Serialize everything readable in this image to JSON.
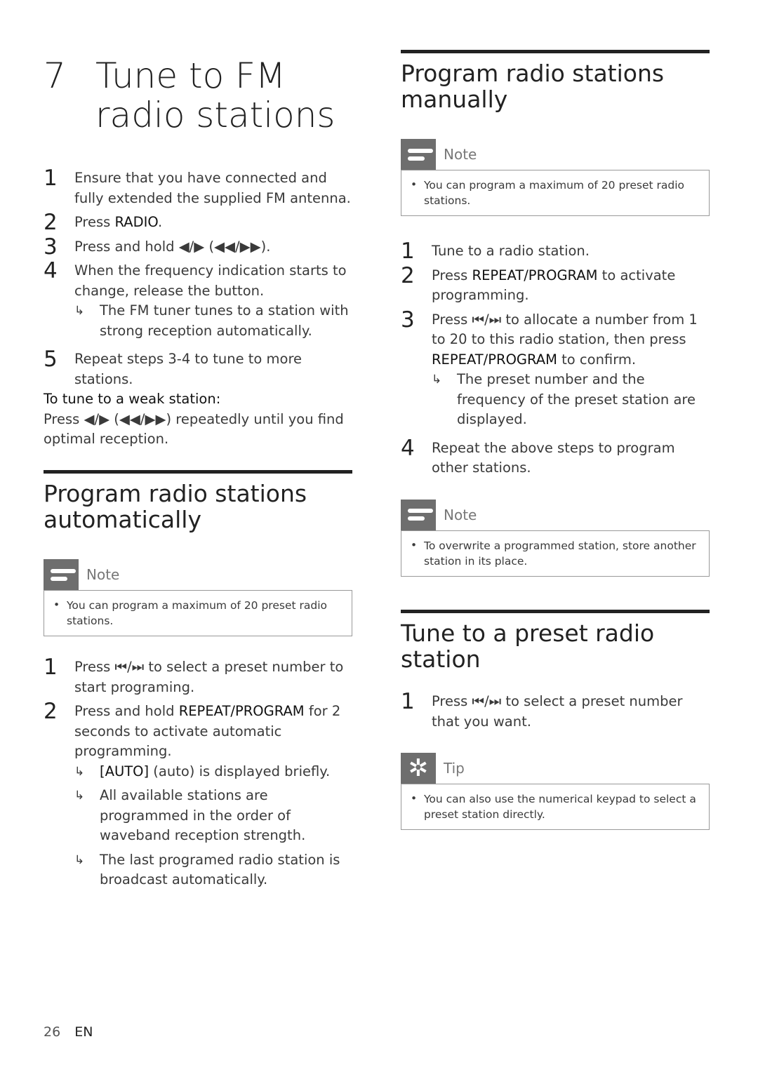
{
  "chapter": {
    "number": "7",
    "title": "Tune to FM radio stations"
  },
  "intro_steps": [
    {
      "n": "1",
      "text": "Ensure that you have connected and fully extended the supplied FM antenna."
    },
    {
      "n": "2",
      "pre": "Press ",
      "bold": "RADIO",
      "post": "."
    },
    {
      "n": "3",
      "text": "Press and hold ◀/▶ (◀◀/▶▶)."
    },
    {
      "n": "4",
      "text": "When the frequency indication starts to change, release the button.",
      "result": "The FM tuner tunes to a station with strong reception automatically."
    },
    {
      "n": "5",
      "text": "Repeat steps 3-4 to tune to more stations."
    }
  ],
  "weak_station": {
    "heading": "To tune to a weak station:",
    "text": "Press ◀/▶ (◀◀/▶▶) repeatedly until you find optimal reception."
  },
  "auto_section": {
    "title": "Program radio stations automatically",
    "note_label": "Note",
    "note_text": "You can program a maximum of 20 preset radio stations.",
    "steps": [
      {
        "n": "1",
        "text": "Press ⏮/⏭ to select a preset number to start programing."
      },
      {
        "n": "2",
        "pre": "Press and hold ",
        "bold": "REPEAT/PROGRAM",
        "post": " for 2 seconds to activate automatic programming."
      }
    ],
    "results": [
      {
        "bold": "[AUTO]",
        "text": " (auto) is displayed briefly."
      },
      {
        "text": "All available stations are programmed in the order of waveband reception strength."
      },
      {
        "text": "The last programed radio station is broadcast automatically."
      }
    ]
  },
  "manual_section": {
    "title": "Program radio stations manually",
    "note_label": "Note",
    "note_text": "You can program a maximum of 20 preset radio stations.",
    "steps": [
      {
        "n": "1",
        "text": "Tune to a radio station."
      },
      {
        "n": "2",
        "pre": "Press ",
        "bold": "REPEAT/PROGRAM",
        "post": " to activate programming."
      },
      {
        "n": "3",
        "pre": "Press ⏮/⏭ to allocate a number from 1 to 20 to this radio station, then press ",
        "bold": "REPEAT/PROGRAM",
        "post": " to confirm.",
        "result": "The preset number and the frequency of the preset station are displayed."
      },
      {
        "n": "4",
        "text": "Repeat the above steps to program other stations."
      }
    ],
    "note2_label": "Note",
    "note2_text": "To overwrite a programmed station, store another station in its place."
  },
  "preset_section": {
    "title": "Tune to a preset radio station",
    "steps": [
      {
        "n": "1",
        "text": "Press ⏮/⏭ to select a preset number that you want."
      }
    ],
    "tip_label": "Tip",
    "tip_text": "You can also use the numerical keypad to select a preset station directly."
  },
  "footer": {
    "page": "26",
    "lang": "EN"
  }
}
